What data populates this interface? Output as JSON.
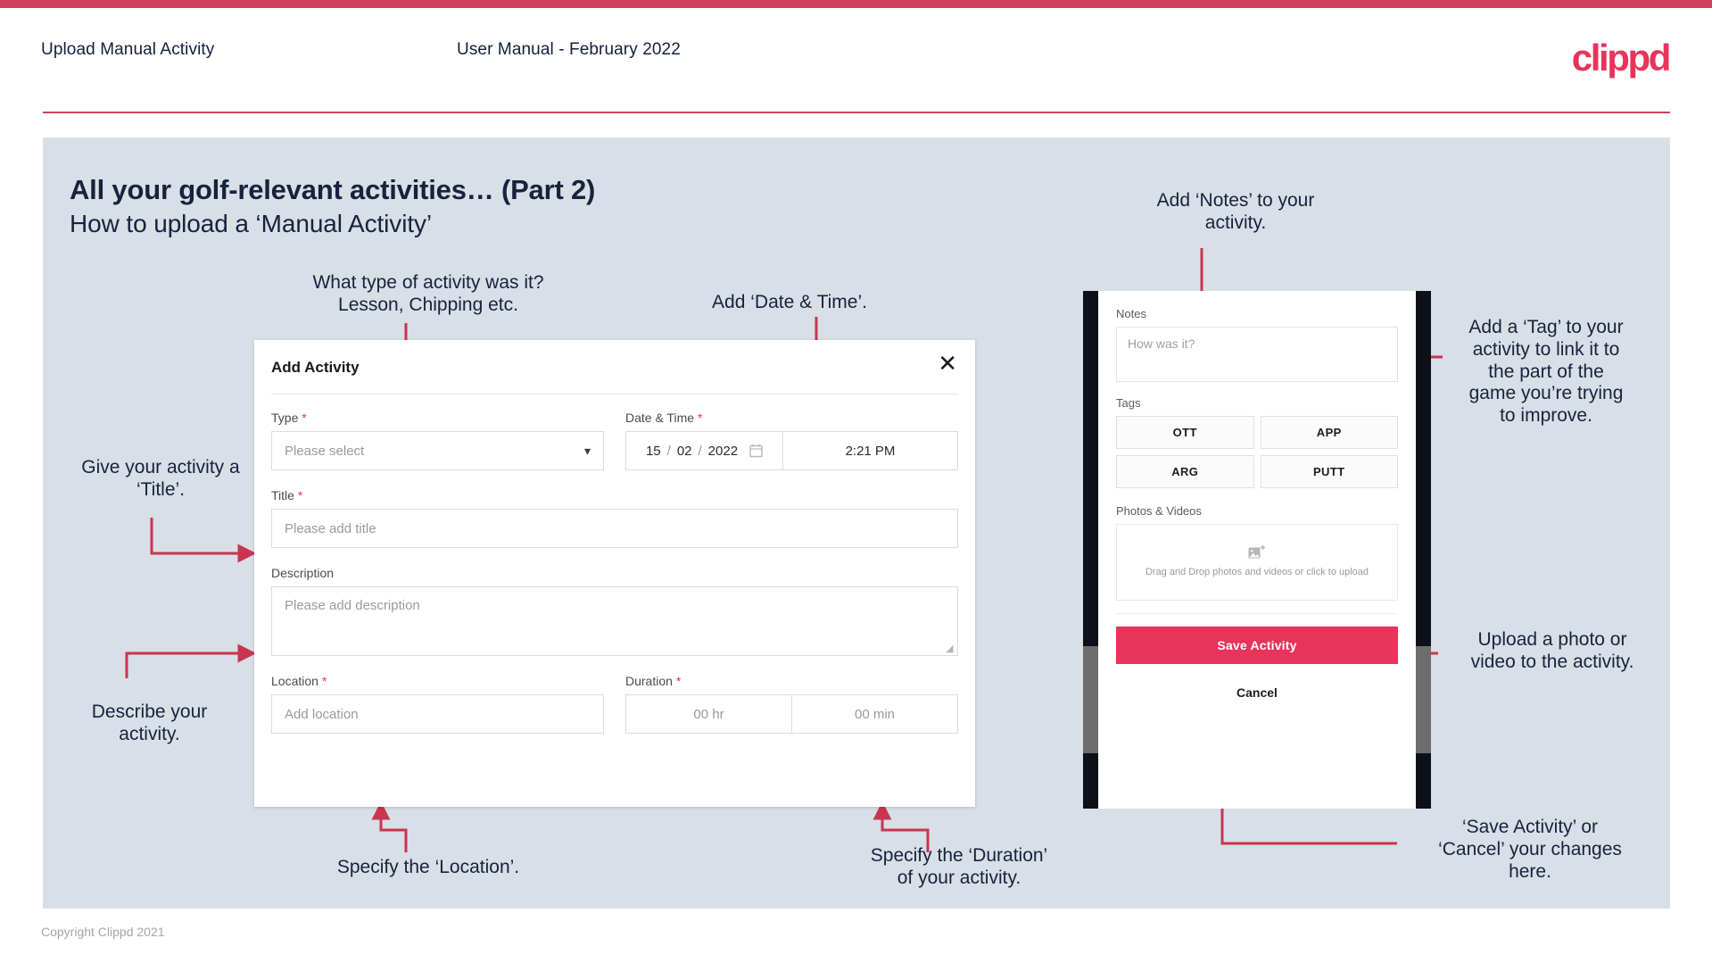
{
  "header": {
    "title": "Upload Manual Activity",
    "subtitle": "User Manual - February 2022",
    "logo": "clippd"
  },
  "slide": {
    "title": "All your golf-relevant activities… (Part 2)",
    "subtitle": "How to upload a ‘Manual Activity’"
  },
  "annotations": {
    "type": "What type of activity was it?\nLesson, Chipping etc.",
    "datetime": "Add ‘Date & Time’.",
    "title": "Give your activity a\n‘Title’.",
    "describe": "Describe your\nactivity.",
    "location": "Specify the ‘Location’.",
    "duration": "Specify the ‘Duration’\nof your activity.",
    "notes": "Add ‘Notes’ to your\nactivity.",
    "tag": "Add a ‘Tag’ to your\nactivity to link it to\nthe part of the\ngame you’re trying\nto improve.",
    "upload": "Upload a photo or\nvideo to the activity.",
    "save": "‘Save Activity’ or\n‘Cancel’ your changes\nhere."
  },
  "dialog": {
    "title": "Add Activity",
    "close_icon": "close-icon",
    "fields": {
      "type": {
        "label": "Type",
        "required": "*",
        "placeholder": "Please select",
        "chevron": "chevron-down-icon"
      },
      "datetime": {
        "label": "Date & Time",
        "required": "*",
        "day": "15",
        "month": "02",
        "year": "2022",
        "sep": "/",
        "calendar_icon": "calendar-icon",
        "time": "2:21 PM"
      },
      "title": {
        "label": "Title",
        "required": "*",
        "placeholder": "Please add title"
      },
      "description": {
        "label": "Description",
        "placeholder": "Please add description"
      },
      "location": {
        "label": "Location",
        "required": "*",
        "placeholder": "Add location"
      },
      "duration": {
        "label": "Duration",
        "required": "*",
        "hours": "00 hr",
        "minutes": "00 min"
      }
    }
  },
  "phone": {
    "notes_label": "Notes",
    "notes_placeholder": "How was it?",
    "tags_label": "Tags",
    "tags": [
      "OTT",
      "APP",
      "ARG",
      "PUTT"
    ],
    "photos_label": "Photos & Videos",
    "upload_icon": "add-image-icon",
    "upload_text": "Drag and Drop photos and videos or\nclick to upload",
    "save_label": "Save Activity",
    "cancel_label": "Cancel"
  },
  "footer": {
    "copyright": "Copyright Clippd 2021"
  },
  "colors": {
    "brand_pink": "#e8335a",
    "bar_red": "#cf4259",
    "slide_bg": "#d9dfe6",
    "ink": "#17223d",
    "connector": "#c9354f"
  }
}
